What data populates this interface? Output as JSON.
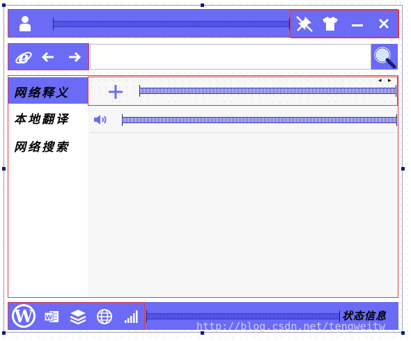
{
  "titlebar": {
    "user_icon": "user-icon",
    "pin_icon": "pin-off-icon",
    "skin_icon": "tshirt-icon",
    "minimize_label": "—",
    "close_label": "✕"
  },
  "toolbar": {
    "browser_icon": "ie-icon",
    "back_label": "←",
    "forward_label": "→",
    "search_value": "",
    "search_icon": "magnifier-icon"
  },
  "sidebar": {
    "items": [
      {
        "label": "网络释义",
        "selected": true
      },
      {
        "label": "本地翻译",
        "selected": false
      },
      {
        "label": "网络搜索",
        "selected": false
      }
    ]
  },
  "content": {
    "add_label": "+",
    "scroll_left": "◂",
    "scroll_right": "▸",
    "speaker_icon": "speaker-icon"
  },
  "statusbar": {
    "icons": [
      "wordpress-icon",
      "word-icon",
      "layers-icon",
      "globe-icon",
      "signal-icon"
    ],
    "status_text": "状态信息",
    "watermark": "http://blog.csdn.net/tengweitw"
  },
  "colors": {
    "accent": "#6b6bf6",
    "border_red": "#e23a3a",
    "content_bg": "#f7f7f7"
  }
}
